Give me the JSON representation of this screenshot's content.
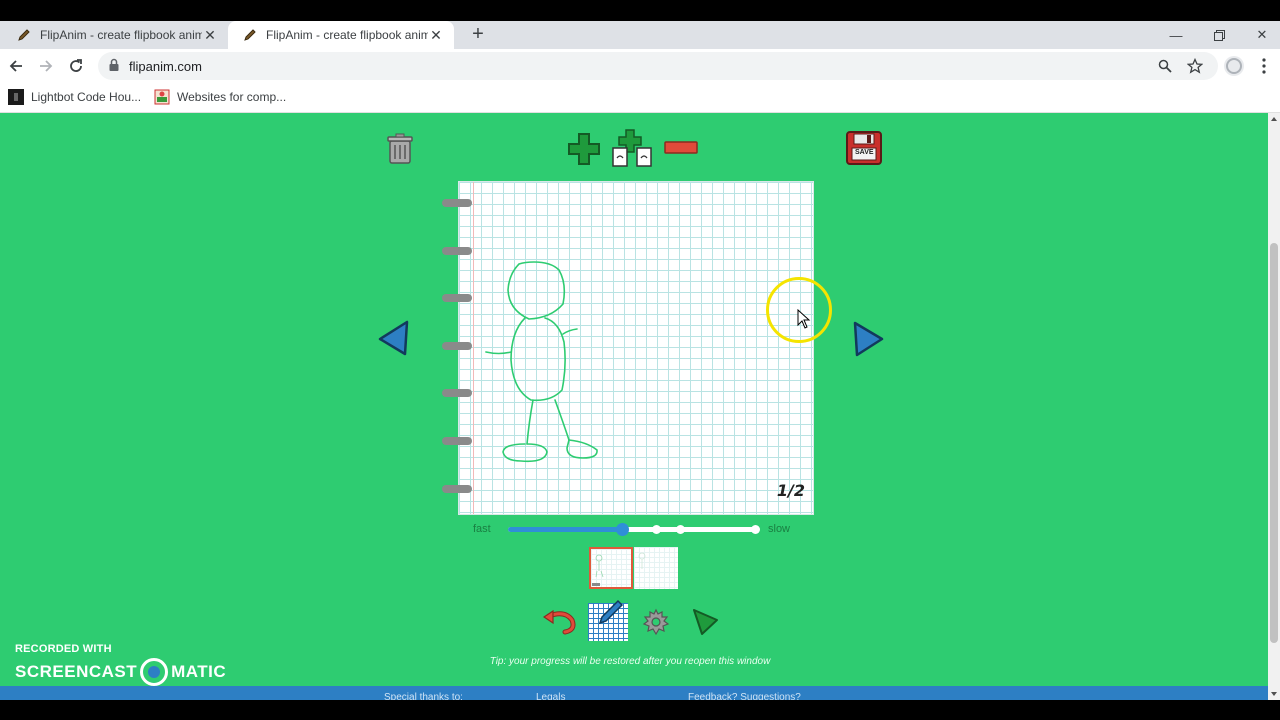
{
  "browser": {
    "tabs": [
      {
        "title": "FlipAnim - create flipbook anima",
        "active": false
      },
      {
        "title": "FlipAnim - create flipbook anima",
        "active": true
      }
    ],
    "new_tab_label": "+",
    "address": "flipanim.com",
    "bookmarks": [
      {
        "label": "Lightbot Code Hou...",
        "icon": "lightbot-icon"
      },
      {
        "label": "Websites for comp...",
        "icon": "bookmark-image-icon"
      }
    ]
  },
  "app": {
    "toolbar_icons": [
      "trash-icon",
      "add-frame-icon",
      "duplicate-frame-icon",
      "remove-frame-icon",
      "save-icon"
    ],
    "save_icon_label": "SAVE",
    "frame_counter": "1/2",
    "speed": {
      "fast_label": "fast",
      "slow_label": "slow",
      "value": 0.46
    },
    "thumbnails": [
      {
        "selected": true
      },
      {
        "selected": false
      }
    ],
    "bottom_tools": [
      "undo-icon",
      "grid-brush-icon",
      "settings-gear-icon",
      "play-icon"
    ],
    "tip": "Tip: your progress will be restored after you reopen this window"
  },
  "footer": {
    "links": [
      "Special thanks to:",
      "Legals",
      "Feedback? Suggestions?"
    ]
  },
  "watermark": {
    "line1": "RECORDED WITH",
    "brand_left": "SCREENCAST",
    "brand_right": "MATIC"
  },
  "colors": {
    "page_bg": "#2ecc71",
    "accent_blue": "#2f8fd8",
    "footer_blue": "#2d7fc4",
    "drawing_stroke": "#2ecc71"
  }
}
